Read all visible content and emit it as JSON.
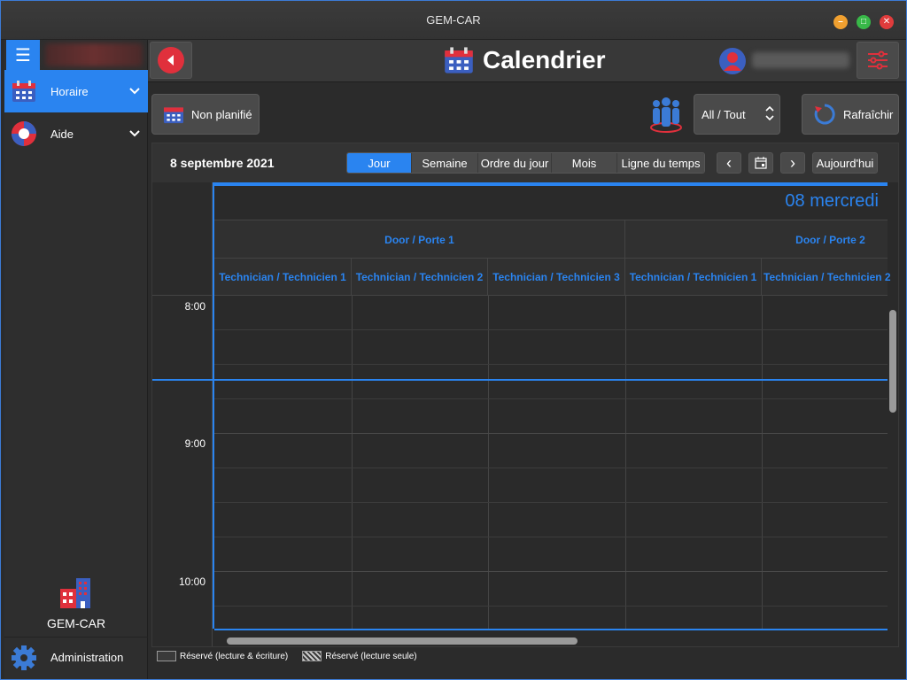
{
  "window": {
    "title": "GEM-CAR"
  },
  "sidebar": {
    "items": [
      {
        "label": "Horaire",
        "icon": "calendar-icon",
        "active": true
      },
      {
        "label": "Aide",
        "icon": "lifebuoy-icon",
        "active": false
      }
    ],
    "app_name": "GEM-CAR",
    "admin_label": "Administration"
  },
  "header": {
    "title": "Calendrier"
  },
  "toolbar": {
    "unplanned_label": "Non planifié",
    "filter_value": "All / Tout",
    "refresh_label": "Rafraîchir"
  },
  "calendar": {
    "date_label": "8 septembre 2021",
    "views": [
      {
        "label": "Jour",
        "active": true
      },
      {
        "label": "Semaine",
        "active": false
      },
      {
        "label": "Ordre du jour",
        "active": false
      },
      {
        "label": "Mois",
        "active": false
      },
      {
        "label": "Ligne du temps",
        "active": false
      }
    ],
    "prev_label": "‹",
    "next_label": "›",
    "today_label": "Aujourd'hui",
    "day_label": "08 mercredi",
    "doors": [
      "Door / Porte 1",
      "Door / Porte 2"
    ],
    "technicians": [
      "Technician / Technicien 1",
      "Technician / Technicien 2",
      "Technician / Technicien 3",
      "Technician / Technicien 1",
      "Technician / Technicien 2"
    ],
    "times": [
      "8:00",
      "9:00",
      "10:00"
    ]
  },
  "legend": {
    "read_write": "Réservé (lecture & écriture)",
    "read_only": "Réservé (lecture seule)"
  },
  "colors": {
    "accent": "#2a84f0",
    "danger": "#e0303c"
  }
}
